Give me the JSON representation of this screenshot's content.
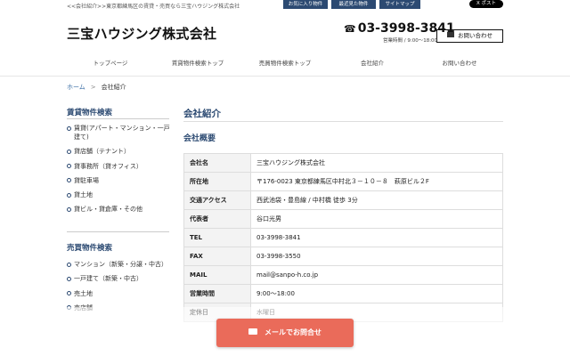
{
  "header": {
    "tagline": "<<会社紹介>>東京都練馬区の賃貸・売買なら三宝ハウジング株式会社",
    "top_buttons": [
      "お気に入り物件",
      "最近見た物件",
      "サイトマップ"
    ],
    "x_post": "X ポスト",
    "logo": "三宝ハウジング株式会社",
    "phone": "03-3998-3841",
    "hours": "営業時間 / 9:00〜18:00",
    "contact_label": "お問い合わせ"
  },
  "nav": {
    "items": [
      "トップページ",
      "賃貸物件検索トップ",
      "売買物件検索トップ",
      "会社紹介",
      "お問い合わせ"
    ]
  },
  "breadcrumb": {
    "home": "ホーム",
    "separator": ">",
    "current": "会社紹介"
  },
  "sidebar": {
    "rent_title": "賃貸物件検索",
    "rent_items": [
      "賃貸(アパート・マンション・一戸建て)",
      "貸店舗（テナント）",
      "貸事務所（貸オフィス）",
      "貸駐車場",
      "貸土地",
      "貸ビル・貸倉庫・その他"
    ],
    "sale_title": "売買物件検索",
    "sale_items": [
      "マンション（新築・分譲・中古）",
      "一戸建て（新築・中古）",
      "売土地",
      "売店舗"
    ]
  },
  "main": {
    "title": "会社紹介",
    "subtitle": "会社概要",
    "rows": [
      {
        "label": "会社名",
        "value": "三宝ハウジング株式会社"
      },
      {
        "label": "所在地",
        "value": "〒176-0023 東京都練馬区中村北３－１０－８　萩原ビル２F"
      },
      {
        "label": "交通アクセス",
        "value": "西武池袋・豊島線 / 中村橋 徒歩 3分"
      },
      {
        "label": "代表者",
        "value": "谷口光男"
      },
      {
        "label": "TEL",
        "value": "03-3998-3841"
      },
      {
        "label": "FAX",
        "value": "03-3998-3550"
      },
      {
        "label": "MAIL",
        "value": "mail@sanpo-h.co.jp"
      },
      {
        "label": "営業時間",
        "value": "9:00〜18:00"
      },
      {
        "label": "定休日",
        "value": "水曜日"
      }
    ]
  },
  "cta": {
    "label": "メールでお問合せ"
  }
}
